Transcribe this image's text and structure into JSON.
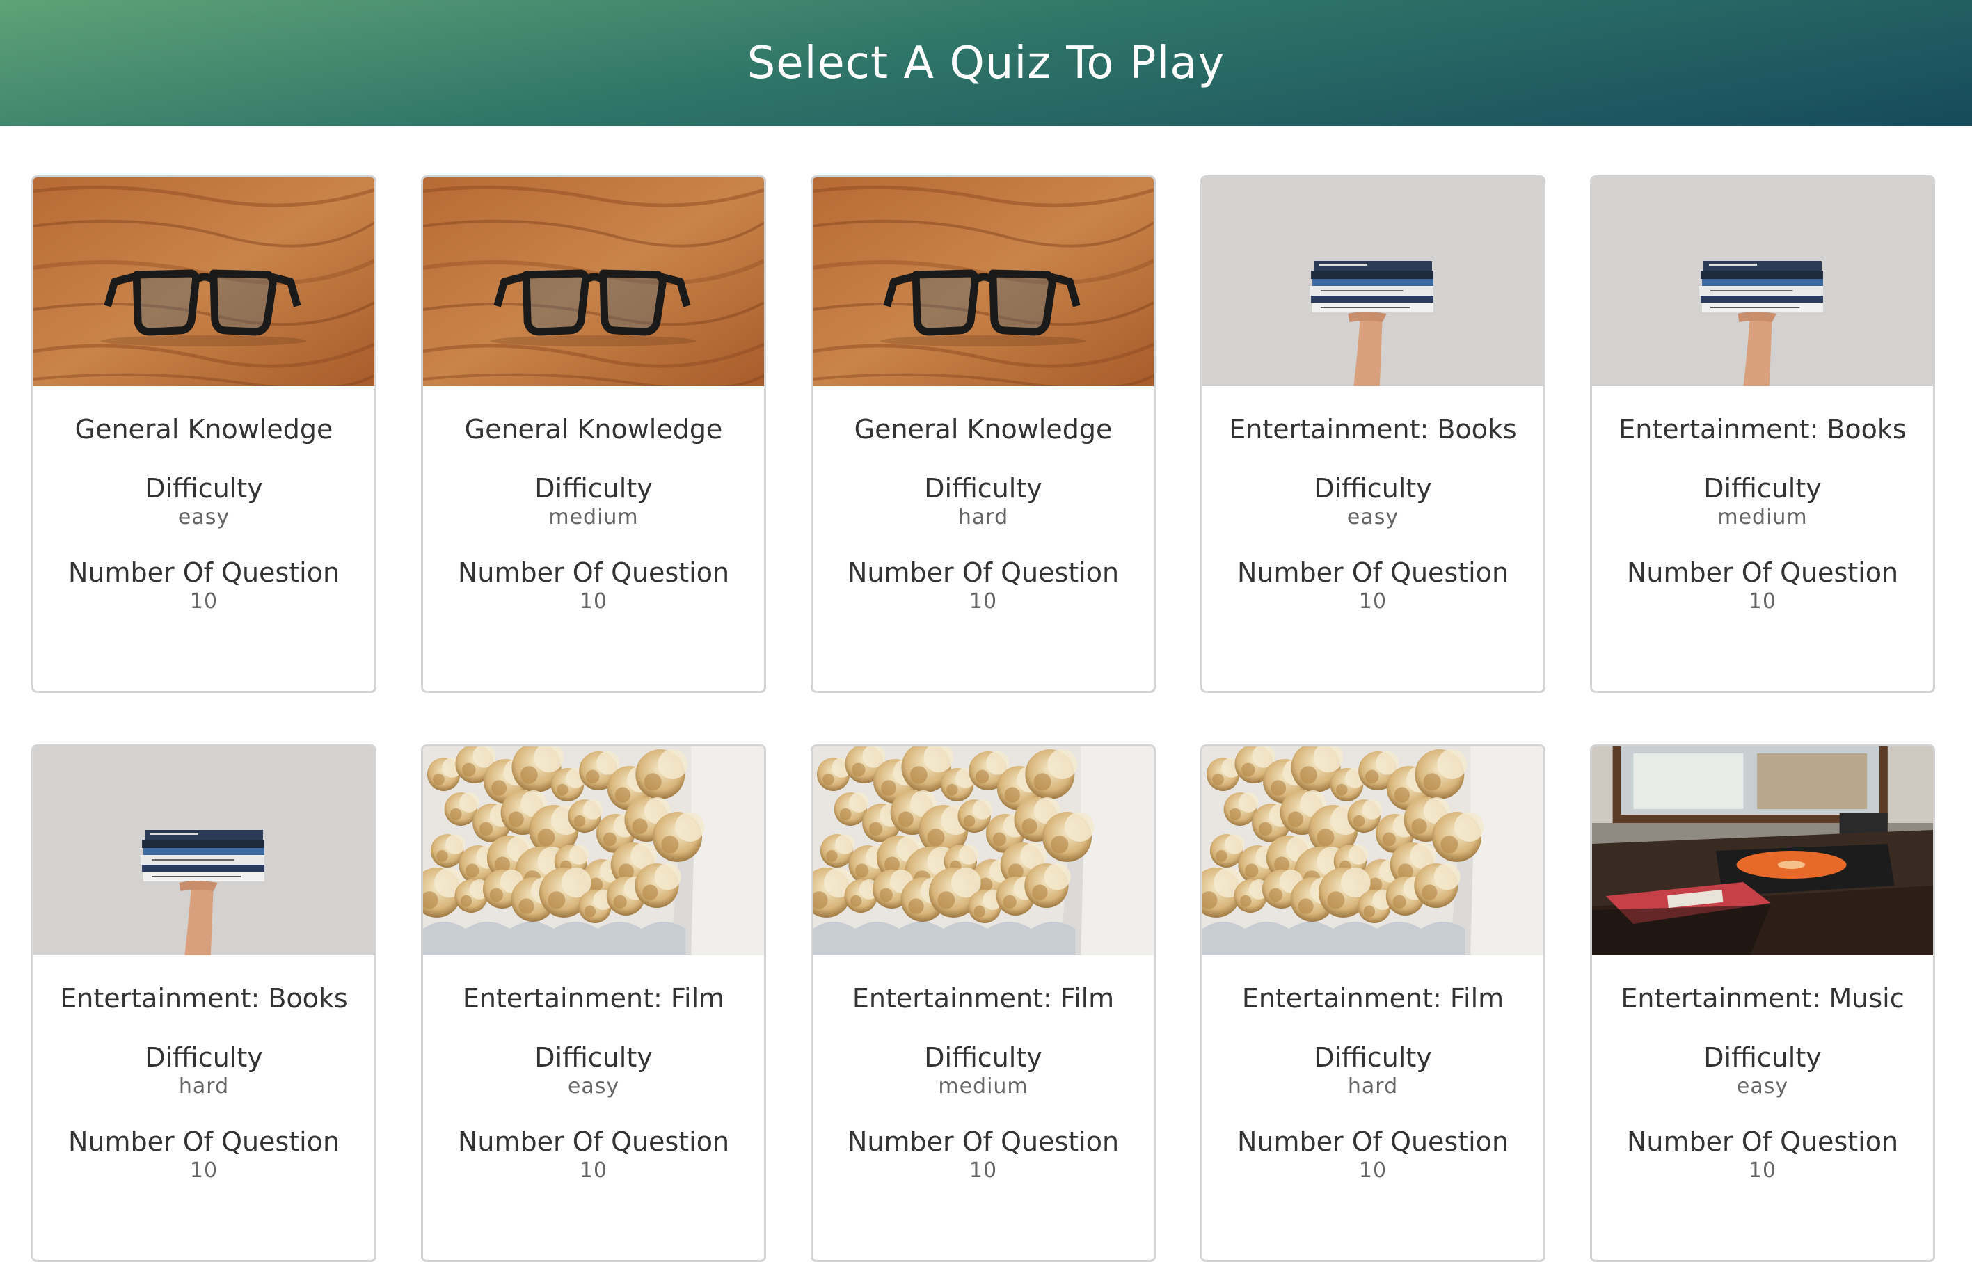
{
  "header": {
    "title": "Select A Quiz To Play"
  },
  "labels": {
    "difficulty": "Difficulty",
    "questions": "Number Of Question"
  },
  "cards": [
    {
      "category": "General Knowledge",
      "difficulty": "easy",
      "questions": "10",
      "image": "glasses-photo"
    },
    {
      "category": "General Knowledge",
      "difficulty": "medium",
      "questions": "10",
      "image": "glasses-photo"
    },
    {
      "category": "General Knowledge",
      "difficulty": "hard",
      "questions": "10",
      "image": "glasses-photo"
    },
    {
      "category": "Entertainment: Books",
      "difficulty": "easy",
      "questions": "10",
      "image": "books-photo"
    },
    {
      "category": "Entertainment: Books",
      "difficulty": "medium",
      "questions": "10",
      "image": "books-photo"
    },
    {
      "category": "Entertainment: Books",
      "difficulty": "hard",
      "questions": "10",
      "image": "books-photo"
    },
    {
      "category": "Entertainment: Film",
      "difficulty": "easy",
      "questions": "10",
      "image": "popcorn-photo"
    },
    {
      "category": "Entertainment: Film",
      "difficulty": "medium",
      "questions": "10",
      "image": "popcorn-photo"
    },
    {
      "category": "Entertainment: Film",
      "difficulty": "hard",
      "questions": "10",
      "image": "popcorn-photo"
    },
    {
      "category": "Entertainment: Music",
      "difficulty": "easy",
      "questions": "10",
      "image": "record-player-photo"
    }
  ],
  "colors": {
    "header_start": "#5ea277",
    "header_end": "#164a5c",
    "card_border": "#d4d4d4"
  }
}
